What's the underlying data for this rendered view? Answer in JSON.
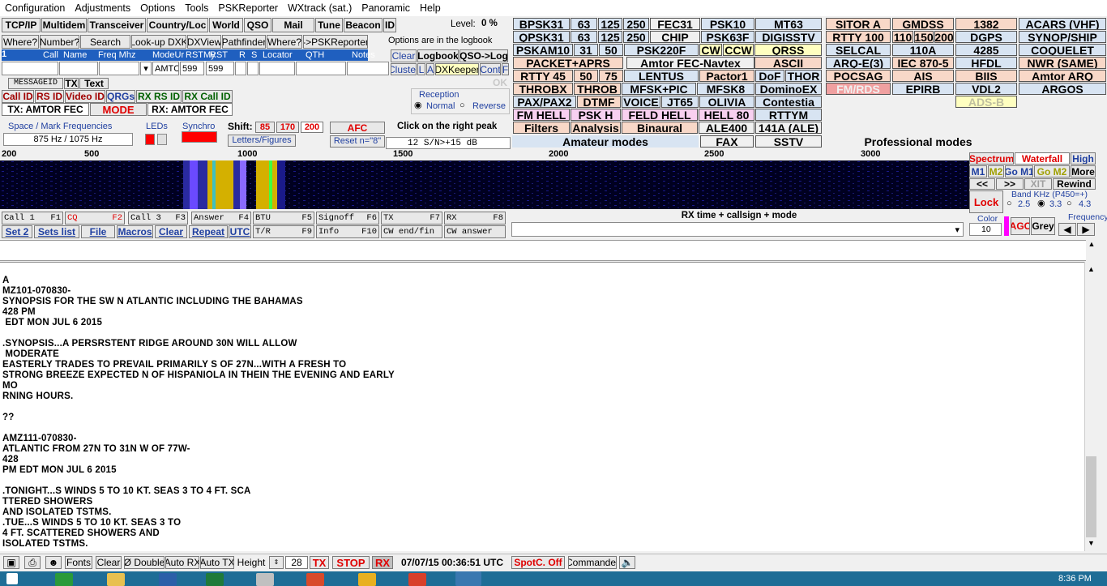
{
  "menu": [
    "Configuration",
    "Adjustments",
    "Options",
    "Tools",
    "PSKReporter",
    "WXtrack (sat.)",
    "Panoramic",
    "Help"
  ],
  "toolbar1": [
    "TCP/IP",
    "Multidem",
    "Transceiver",
    "Country/Loc",
    "World",
    "QSO",
    "Mail",
    "Tune",
    "Beacon",
    "ID"
  ],
  "level_label": "Level:",
  "level_value": "0 %",
  "toolbar2": [
    "Where?",
    "Number?",
    "Search",
    "Look-up DXK",
    "DXView",
    "Pathfinder",
    "Where?",
    "->PSKReporter"
  ],
  "logbook_note": "Options are in the logbook",
  "log_headers": [
    "Call",
    "Name",
    "Freq Mhz",
    "ModeUr",
    "RSTMy",
    "RST",
    "R",
    "S",
    "Locator",
    "QTH",
    "Notes"
  ],
  "log_row": {
    "num": "1",
    "mode": "AMTC",
    "rst1": "599",
    "rst2": "599"
  },
  "log_buttons": [
    "Clear",
    "Logbook",
    "QSO->Log",
    "Cluster",
    "L",
    "A",
    "DXKeeper",
    "Cont",
    "F"
  ],
  "tabs": [
    "MESSAGEID",
    "TX",
    "Text"
  ],
  "ok_label": "OK",
  "id_buttons": [
    "Call ID",
    "RS ID",
    "Video ID",
    "QRGs",
    "RX RS ID",
    "RX Call ID"
  ],
  "tx_mode": "TX: AMTOR FEC",
  "mode_label": "MODE",
  "rx_mode": "RX: AMTOR FEC",
  "reception": {
    "label": "Reception",
    "normal": "Normal",
    "reverse": "Reverse"
  },
  "space_mark": {
    "label": "Space / Mark Frequencies",
    "value": "875 Hz / 1075 Hz"
  },
  "leds_label": "LEDs",
  "synchro_label": "Synchro",
  "shift": {
    "label": "Shift:",
    "v1": "85",
    "v2": "170",
    "v3": "200"
  },
  "afc_label": "AFC",
  "letters_figures": "Letters/Figures",
  "reset_label": "Reset n=\"8\"",
  "click_peak": "Click on the right peak",
  "snr": {
    "num": "12",
    "text": "S/N>+15 dB"
  },
  "amateur_modes": [
    [
      "BPSK31",
      "63",
      "125",
      "250",
      "FEC31",
      "PSK10",
      "MT63"
    ],
    [
      "QPSK31",
      "63",
      "125",
      "250",
      "CHIP",
      "PSK63F",
      "DIGISSTV"
    ],
    [
      "PSKAM10",
      "31",
      "50",
      "PSK220F",
      "CW",
      "CCW",
      "QRSS"
    ],
    [
      "PACKET+APRS",
      "Amtor FEC-Navtex",
      "ASCII"
    ],
    [
      "RTTY 45",
      "50",
      "75",
      "LENTUS",
      "Pactor1",
      "DoF",
      "THOR"
    ],
    [
      "THROBX",
      "THROB",
      "MFSK+PIC",
      "MFSK8",
      "DominoEX"
    ],
    [
      "PAX/PAX2",
      "DTMF",
      "VOICE",
      "JT65",
      "OLIVIA",
      "Contestia"
    ],
    [
      "FM HELL",
      "PSK H",
      "FELD HELL",
      "HELL 80",
      "RTTYM"
    ],
    [
      "Filters",
      "Analysis",
      "Binaural",
      "ALE400",
      "141A (ALE)"
    ],
    [
      "FAX",
      "SSTV"
    ]
  ],
  "amateur_label": "Amateur modes",
  "pro_modes": [
    [
      "SITOR A",
      "GMDSS",
      "1382",
      "ACARS (VHF)"
    ],
    [
      "RTTY 100",
      "110",
      "150",
      "200",
      "DGPS",
      "SYNOP/SHIP"
    ],
    [
      "SELCAL",
      "110A",
      "4285",
      "COQUELET"
    ],
    [
      "ARQ-E(3)",
      "IEC 870-5",
      "HFDL",
      "NWR (SAME)"
    ],
    [
      "POCSAG",
      "AIS",
      "BIIS",
      "Amtor ARQ"
    ],
    [
      "FM/RDS",
      "EPIRB",
      "VDL2",
      "ARGOS"
    ],
    [
      "ADS-B"
    ]
  ],
  "pro_label": "Professional modes",
  "scale": [
    "200",
    "500",
    "1000",
    "1500",
    "2000",
    "2500",
    "3000"
  ],
  "spectrum_buttons": [
    "Spectrum",
    "Waterfall",
    "High",
    "M1",
    "M2",
    "Go M1",
    "Go M2",
    "More",
    "<<",
    ">>",
    "XIT",
    "Rewind",
    "Lock"
  ],
  "band": {
    "label": "Band KHz (P450=+)",
    "o1": "2.5",
    "o2": "3.3",
    "o3": "4.3"
  },
  "color": {
    "label": "Color",
    "value": "10",
    "agc": "AGC",
    "grey": "Grey",
    "freq": "Frequency"
  },
  "fkeys": [
    [
      "Call 1",
      "F1"
    ],
    [
      "CQ",
      "F2"
    ],
    [
      "Call 3",
      "F3"
    ],
    [
      "Answer",
      "F4"
    ],
    [
      "BTU",
      "F5"
    ],
    [
      "Signoff",
      "F6"
    ],
    [
      "TX",
      "F7"
    ],
    [
      "RX",
      "F8"
    ]
  ],
  "fkeys2": [
    [
      "Set 2",
      ""
    ],
    [
      "Sets list",
      ""
    ],
    [
      "File",
      ""
    ],
    [
      "Macros",
      ""
    ],
    [
      "Clear",
      ""
    ],
    [
      "Repeat",
      ""
    ],
    [
      "UTC",
      ""
    ],
    [
      "T/R",
      "F9"
    ],
    [
      "Info",
      "F10"
    ],
    [
      "CW end/fin",
      ""
    ],
    [
      "CW answer",
      ""
    ]
  ],
  "rx_time_label": "RX time + callsign + mode",
  "received_text": "A\nMZ101-070830-\nSYNOPSIS FOR THE SW N ATLANTIC INCLUDING THE BAHAMAS\n428 PM\n EDT MON JUL 6 2015\n\n.SYNOPSIS...A PERSRSTENT RIDGE AROUND 30N WILL ALLOW\n MODERATE\nEASTERLY TRADES TO PREVAIL PRIMARILY S OF 27N...WITH A FRESH TO\nSTRONG BREEZE EXPECTED N OF HISPANIOLA IN THEIN THE EVENING AND EARLY\nMO\nRNING HOURS.\n\n??\n\nAMZ111-070830-\nATLANTIC FROM 27N TO 31N W OF 77W-\n428\nPM EDT MON JUL 6 2015\n\n.TONIGHT...S WINDS 5 TO 10 KT. SEAS 3 TO 4 FT. SCA\nTTERED SHOWERS\nAND ISOLATED TSTMS.\n.TUE...S WINDS 5 TO 10 KT. SEAS 3 TO\n4 FT. SCATTERED SHOWERS AND\nISOLATED TSTMS.",
  "status": {
    "fonts": "Fonts",
    "clear": "Clear",
    "double": "Ø Double",
    "autorx": "Auto RX",
    "autotx": "Auto TX",
    "height": "Height",
    "height_val": "28",
    "tx": "TX",
    "stop": "STOP",
    "rx": "RX",
    "datetime": "07/07/15 00:36:51 UTC",
    "spotc": "SpotC. Off",
    "commander": "Commander"
  },
  "clock": "8:36 PM"
}
